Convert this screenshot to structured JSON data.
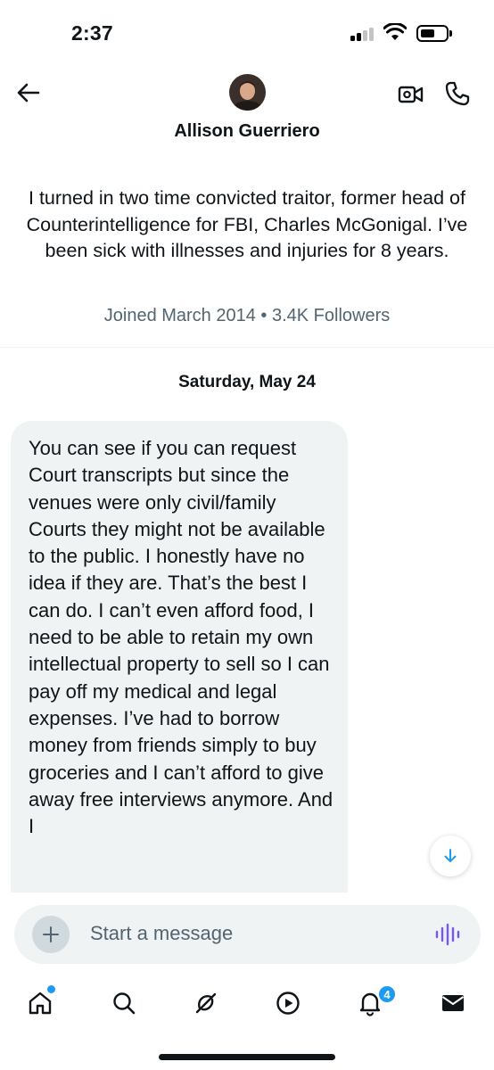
{
  "status_bar": {
    "time": "2:37",
    "battery_level": 0.45,
    "signal_bars": 2
  },
  "header": {
    "contact_name": "Allison Guerriero",
    "icons": {
      "back": "arrow-left-icon",
      "video": "video-camera-icon",
      "phone": "phone-icon"
    }
  },
  "profile": {
    "bio": "I turned in two time convicted traitor, former head of Counterintelligence for FBI, Charles McGonigal. I’ve been sick with illnesses and injuries for 8 years.",
    "meta": "Joined March 2014 • 3.4K Followers"
  },
  "conversation": {
    "date_separator": "Saturday, May 24",
    "messages": [
      {
        "text": "You can see if you can request Court transcripts but since the venues were only civil/family Courts they might not be available to the public. I honestly have no idea if they are. That’s the best I can do. I can’t even afford food, I need to be able to retain my own intellectual property to sell so I can pay off my medical and legal expenses. I’ve had to borrow money from friends simply to buy groceries and I can’t afford to give away free interviews anymore. And I"
      }
    ]
  },
  "composer": {
    "placeholder": "Start a message",
    "voice_color": "#7856ff"
  },
  "tabbar": {
    "tabs": [
      "home-icon",
      "search-icon",
      "grok-icon",
      "video-icon",
      "notifications-icon",
      "messages-icon"
    ],
    "notification_count": "4"
  },
  "colors": {
    "accent": "#1d9bf0",
    "bubble": "#eff3f4",
    "secondary_text": "#536471"
  }
}
